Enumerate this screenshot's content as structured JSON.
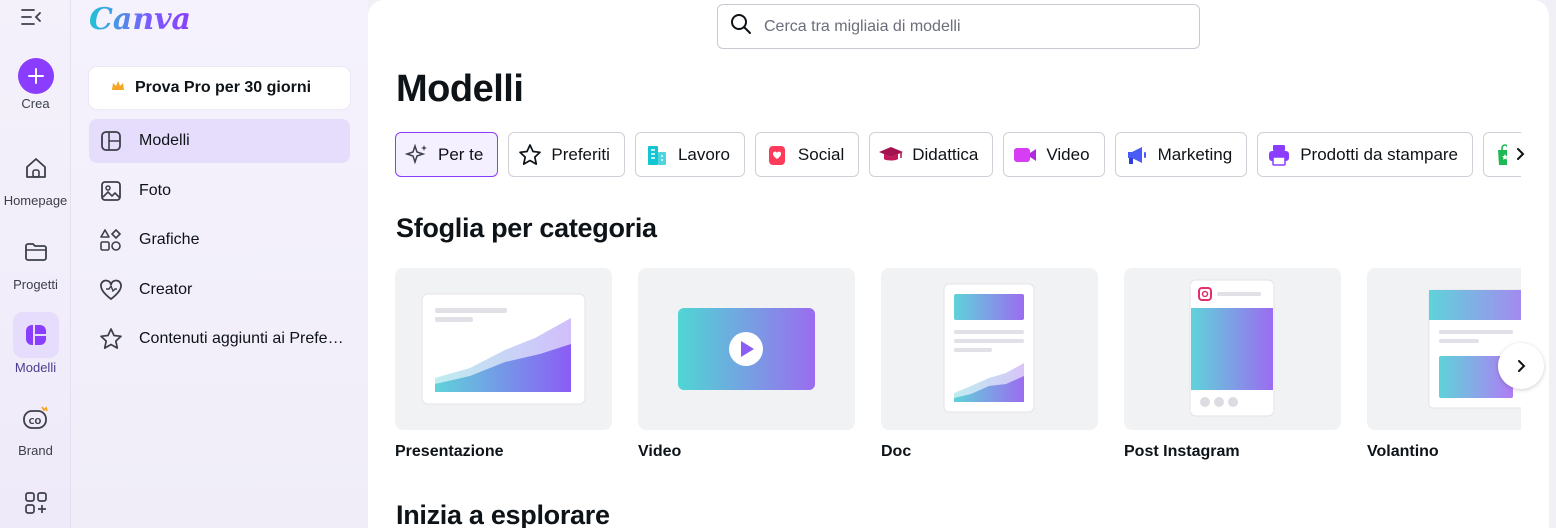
{
  "rail": {
    "items": [
      {
        "label": "Crea"
      },
      {
        "label": "Homepage"
      },
      {
        "label": "Progetti"
      },
      {
        "label": "Modelli"
      },
      {
        "label": "Brand"
      }
    ]
  },
  "sidebar": {
    "logo": "Canva",
    "trial_label": "Prova Pro per 30 giorni",
    "items": [
      {
        "label": "Modelli",
        "icon": "template-icon"
      },
      {
        "label": "Foto",
        "icon": "photo-icon"
      },
      {
        "label": "Grafiche",
        "icon": "shapes-icon"
      },
      {
        "label": "Creator",
        "icon": "heart-icon"
      },
      {
        "label": "Contenuti aggiunti ai Preferiti",
        "icon": "star-icon"
      }
    ]
  },
  "search": {
    "placeholder": "Cerca tra migliaia di modelli"
  },
  "main": {
    "title": "Modelli",
    "chips": [
      {
        "label": "Per te"
      },
      {
        "label": "Preferiti"
      },
      {
        "label": "Lavoro"
      },
      {
        "label": "Social"
      },
      {
        "label": "Didattica"
      },
      {
        "label": "Video"
      },
      {
        "label": "Marketing"
      },
      {
        "label": "Prodotti da stampare"
      }
    ],
    "browse_title": "Sfoglia per categoria",
    "categories": [
      {
        "label": "Presentazione"
      },
      {
        "label": "Video"
      },
      {
        "label": "Doc"
      },
      {
        "label": "Post Instagram"
      },
      {
        "label": "Volantino"
      }
    ],
    "explore_title": "Inizia a esplorare"
  },
  "colors": {
    "accent": "#8b3dff",
    "active_bg": "#e6dcfb"
  }
}
